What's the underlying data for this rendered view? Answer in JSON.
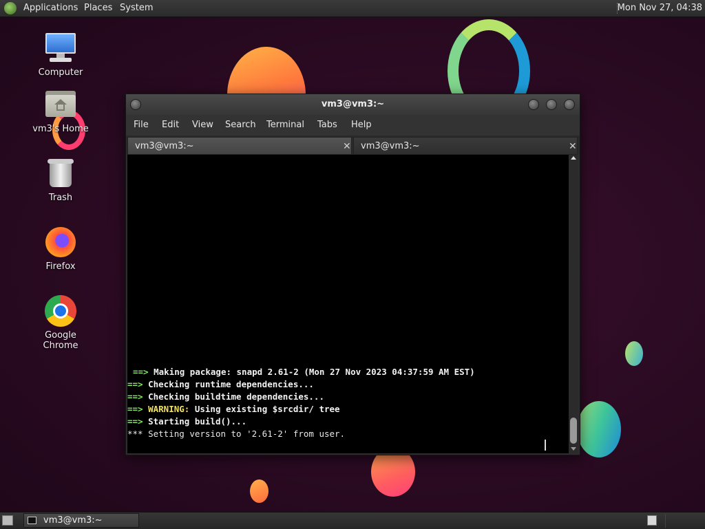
{
  "top_panel": {
    "menus": [
      "Applications",
      "Places",
      "System"
    ],
    "clock": "Mon Nov 27, 04:38"
  },
  "desktop_icons": [
    {
      "label": "Computer",
      "icon": "computer-icon"
    },
    {
      "label": "vm3's Home",
      "icon": "home-folder-icon"
    },
    {
      "label": "Trash",
      "icon": "trash-icon"
    },
    {
      "label": "Firefox",
      "icon": "firefox-icon"
    },
    {
      "label": "Google Chrome",
      "icon": "chrome-icon"
    }
  ],
  "window": {
    "title": "vm3@vm3:~",
    "menu": [
      "File",
      "Edit",
      "View",
      "Search",
      "Terminal",
      "Tabs",
      "Help"
    ],
    "tabs": [
      {
        "label": "vm3@vm3:~",
        "active": true
      },
      {
        "label": "vm3@vm3:~",
        "active": false
      }
    ],
    "terminal_lines": [
      {
        "prefix": "==>",
        "warn": "",
        "text": "Making package: snapd 2.61-2 (Mon 27 Nov 2023 04:37:59 AM EST)"
      },
      {
        "prefix": "==>",
        "warn": "",
        "text": "Checking runtime dependencies..."
      },
      {
        "prefix": "==>",
        "warn": "",
        "text": "Checking buildtime dependencies..."
      },
      {
        "prefix": "==>",
        "warn": "WARNING:",
        "text": "Using existing $srcdir/ tree"
      },
      {
        "prefix": "==>",
        "warn": "",
        "text": "Starting build()..."
      },
      {
        "prefix": "***",
        "warn": "",
        "text": "Setting version to '2.61-2' from user."
      }
    ]
  },
  "taskbar": {
    "task_label": "vm3@vm3:~"
  },
  "colors": {
    "prompt_arrow": "#7ee85f",
    "warning": "#f0e060",
    "desktop_bg": "#2a0a22"
  }
}
